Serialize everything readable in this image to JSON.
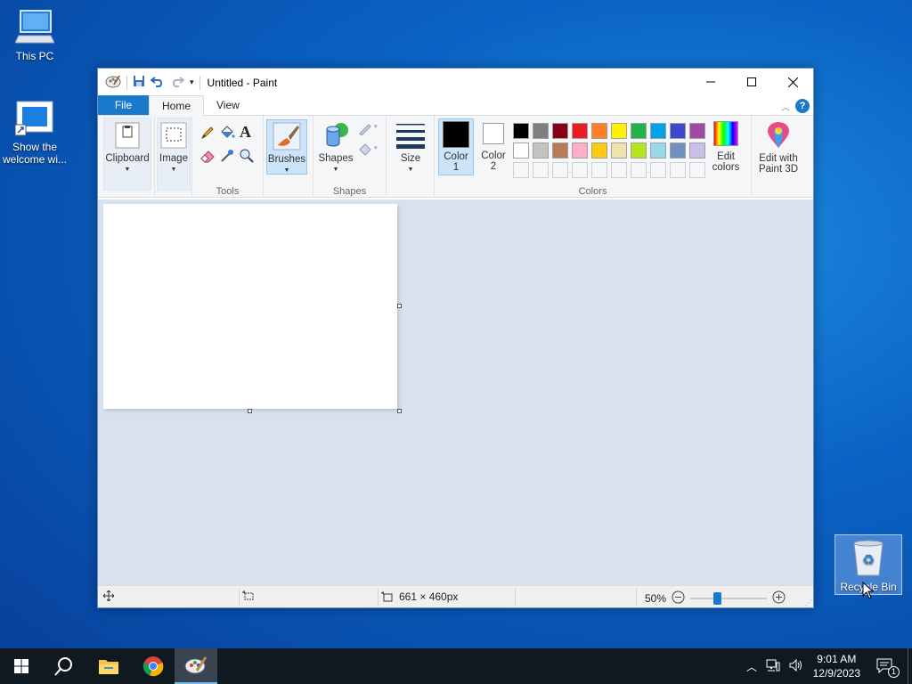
{
  "desktop": {
    "icons": [
      {
        "label": "This PC"
      },
      {
        "label": "Show the welcome wi..."
      },
      {
        "label": "Recycle Bin"
      }
    ]
  },
  "window": {
    "title": "Untitled - Paint",
    "tabs": {
      "file": "File",
      "home": "Home",
      "view": "View"
    },
    "help": "?"
  },
  "ribbon": {
    "clipboard": "Clipboard",
    "image": "Image",
    "tools_label": "Tools",
    "brushes": "Brushes",
    "shapes_btn": "Shapes",
    "shapes_label": "Shapes",
    "size": "Size",
    "color1_line1": "Color",
    "color1_line2": "1",
    "color2_line1": "Color",
    "color2_line2": "2",
    "colors_label": "Colors",
    "edit_colors_line1": "Edit",
    "edit_colors_line2": "colors",
    "paint3d_line1": "Edit with",
    "paint3d_line2": "Paint 3D",
    "palette_row1": [
      "#000000",
      "#7f7f7f",
      "#880015",
      "#ed1c24",
      "#ff7f27",
      "#fff200",
      "#22b14c",
      "#00a2e8",
      "#3f48cc",
      "#a349a4"
    ],
    "palette_row2": [
      "#ffffff",
      "#c3c3c3",
      "#b97a57",
      "#ffaec9",
      "#ffc90e",
      "#efe4b0",
      "#b5e61d",
      "#99d9ea",
      "#7092be",
      "#c8bfe7"
    ],
    "color1_value": "#000000",
    "color2_value": "#ffffff"
  },
  "status": {
    "canvas_size": "661 × 460px",
    "zoom": "50%",
    "zoom_level": 0.5
  },
  "taskbar": {
    "time": "9:01 AM",
    "date": "12/9/2023",
    "notification_count": "1"
  }
}
